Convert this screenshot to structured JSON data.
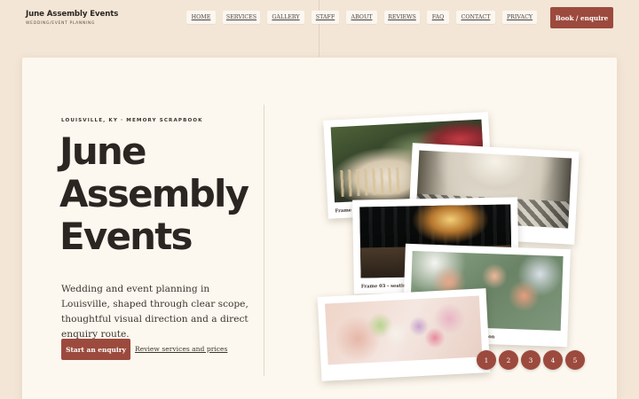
{
  "brand": {
    "name": "June Assembly Events",
    "tagline": "WEDDING/EVENT PLANNING"
  },
  "nav": {
    "items": [
      "HOME",
      "SERVICES",
      "GALLERY",
      "STAFF",
      "ABOUT",
      "REVIEWS",
      "FAQ",
      "CONTACT",
      "PRIVACY"
    ],
    "cta": "Book / enquire"
  },
  "hero": {
    "eyebrow": "LOUISVILLE, KY · MEMORY SCRAPBOOK",
    "title_lines": [
      "June",
      "Assembly",
      "Events"
    ],
    "description": "Wedding and event planning in Louisville, shaped through clear scope, thoughtful visual direction and a direct enquiry route.",
    "primary_cta": "Start an enquiry",
    "secondary_link": "Review services and prices"
  },
  "gallery": {
    "captions": {
      "frame1": "Frame 0",
      "frame3": "Frame 03 - seating.",
      "frame4": "on"
    },
    "pager": [
      "1",
      "2",
      "3",
      "4",
      "5"
    ]
  },
  "colors": {
    "accent": "#9c4a3d",
    "background": "#f3e6d6",
    "card": "#fdf8ef"
  }
}
